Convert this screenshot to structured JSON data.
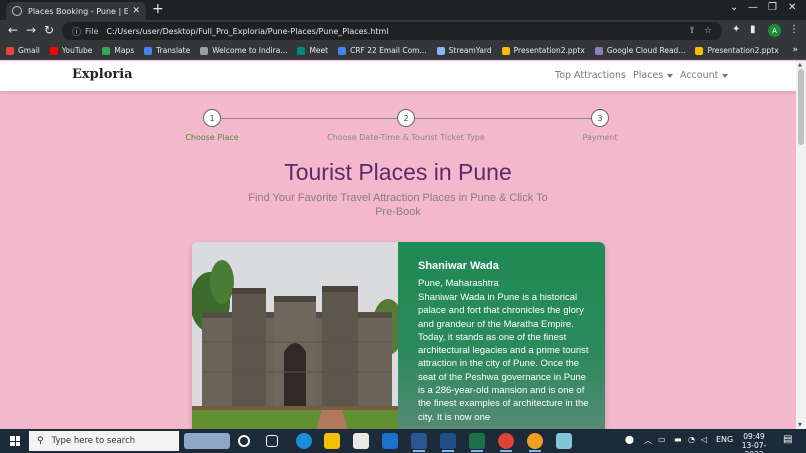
{
  "browser": {
    "tab_title": "Places Booking - Pune | Exploria",
    "tab_close": "✕",
    "new_tab": "+",
    "file_label": "File",
    "url": "C:/Users/user/Desktop/Full_Pro_Exploria/Pune-Places/Pune_Places.html",
    "profile_initial": "A",
    "bookmarks": [
      {
        "label": "Gmail",
        "color": "#ea4335"
      },
      {
        "label": "YouTube",
        "color": "#ff0000"
      },
      {
        "label": "Maps",
        "color": "#34a853"
      },
      {
        "label": "Translate",
        "color": "#4285f4"
      },
      {
        "label": "Welcome to Indira...",
        "color": "#9aa0a6"
      },
      {
        "label": "Meet",
        "color": "#00897b"
      },
      {
        "label": "CRF 22 Email Com...",
        "color": "#4285f4"
      },
      {
        "label": "StreamYard",
        "color": "#8ab4f8"
      },
      {
        "label": "Presentation2.pptx",
        "color": "#fbbc04"
      },
      {
        "label": "Google Cloud Read...",
        "color": "#8e7cc3"
      },
      {
        "label": "Presentation2.pptx",
        "color": "#fbbc04"
      }
    ]
  },
  "site": {
    "brand": "Exploria",
    "nav": {
      "top_attractions": "Top Attractions",
      "places": "Places",
      "account": "Account"
    },
    "stepper": [
      {
        "number": "1",
        "label": "Choose Place",
        "active": true
      },
      {
        "number": "2",
        "label": "Choose Date-Time & Tourist Ticket Type",
        "active": false
      },
      {
        "number": "3",
        "label": "Payment",
        "active": false
      }
    ],
    "heading": "Tourist Places in Pune",
    "subheading": "Find Your Favorite Travel Attraction Places in Pune & Click To Pre-Book",
    "card": {
      "title": "Shaniwar Wada",
      "location": "Pune, Maharashtra",
      "description": "Shaniwar Wada in Pune is a historical palace and fort that chronicles the glory and grandeur of the Maratha Empire. Today, it stands as one of the finest architectural legacies and a prime tourist attraction in the city of Pune. Once the seat of the Peshwa governance in Pune is a 286-year-old mansion and is one of the finest examples of architecture in the city. It is now one"
    }
  },
  "taskbar": {
    "search_placeholder": "Type here to search",
    "language": "ENG",
    "time": "09:49",
    "date": "13-07-2022"
  }
}
